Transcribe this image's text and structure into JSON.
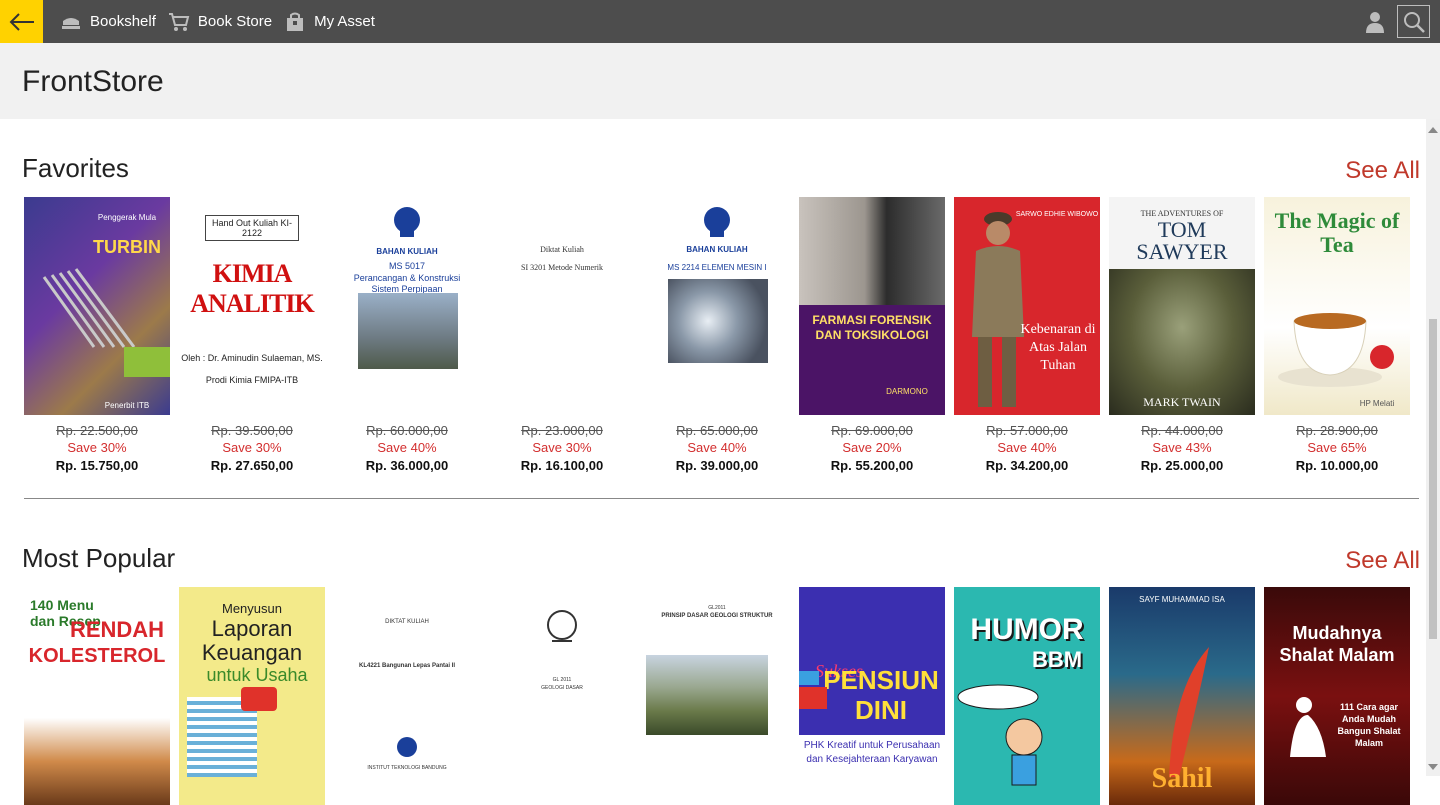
{
  "nav": {
    "items": [
      {
        "label": "Bookshelf",
        "icon": "bookshelf-icon"
      },
      {
        "label": "Book Store",
        "icon": "cart-icon"
      },
      {
        "label": "My Asset",
        "icon": "bag-icon"
      }
    ]
  },
  "page": {
    "title": "FrontStore"
  },
  "favorites": {
    "title": "Favorites",
    "see_all": "See All",
    "books": [
      {
        "cover_lines": [
          "Penggerak Mula",
          "TURBIN",
          "Penerbit ITB"
        ],
        "old_price": "Rp. 22.500,00",
        "save": "Save 30%",
        "price": "Rp. 15.750,00"
      },
      {
        "cover_lines": [
          "Hand Out Kuliah KI-2122",
          "KIMIA ANALITIK",
          "Oleh : Dr. Aminudin Sulaeman, MS.",
          "Prodi Kimia FMIPA-ITB"
        ],
        "old_price": "Rp. 39.500,00",
        "save": "Save 30%",
        "price": "Rp. 27.650,00"
      },
      {
        "cover_lines": [
          "BAHAN KULIAH",
          "MS 5017",
          "Perancangan & Konstruksi",
          "Sistem Perpipaan"
        ],
        "old_price": "Rp. 60.000,00",
        "save": "Save 40%",
        "price": "Rp. 36.000,00"
      },
      {
        "cover_lines": [
          "Diktat Kuliah",
          "SI 3201 Metode Numerik"
        ],
        "old_price": "Rp. 23.000,00",
        "save": "Save 30%",
        "price": "Rp. 16.100,00"
      },
      {
        "cover_lines": [
          "BAHAN KULIAH",
          "MS 2214 ELEMEN MESIN I"
        ],
        "old_price": "Rp. 65.000,00",
        "save": "Save 40%",
        "price": "Rp. 39.000,00"
      },
      {
        "cover_lines": [
          "FARMASI FORENSIK DAN TOKSIKOLOGI",
          "DARMONO"
        ],
        "old_price": "Rp. 69.000,00",
        "save": "Save 20%",
        "price": "Rp. 55.200,00"
      },
      {
        "cover_lines": [
          "SARWO EDHIE WIBOWO",
          "Kebenaran di Atas Jalan Tuhan"
        ],
        "old_price": "Rp. 57.000,00",
        "save": "Save 40%",
        "price": "Rp. 34.200,00"
      },
      {
        "cover_lines": [
          "THE ADVENTURES OF",
          "TOM SAWYER",
          "MARK TWAIN"
        ],
        "old_price": "Rp. 44.000,00",
        "save": "Save 43%",
        "price": "Rp. 25.000,00"
      },
      {
        "cover_lines": [
          "The Magic of Tea",
          "HP Melati"
        ],
        "old_price": "Rp. 28.900,00",
        "save": "Save 65%",
        "price": "Rp. 10.000,00"
      }
    ]
  },
  "popular": {
    "title": "Most Popular",
    "see_all": "See All",
    "books": [
      {
        "cover_lines": [
          "140 Menu dan Resep",
          "RENDAH",
          "KOLESTEROL"
        ]
      },
      {
        "cover_lines": [
          "Menyusun",
          "Laporan Keuangan",
          "untuk Usaha"
        ]
      },
      {
        "cover_lines": [
          "DIKTAT KULIAH",
          "KL4221 Bangunan Lepas Pantai II",
          "INSTITUT TEKNOLOGI BANDUNG"
        ]
      },
      {
        "cover_lines": [
          "GL 2011",
          "GEOLOGI DASAR"
        ]
      },
      {
        "cover_lines": [
          "GL2011",
          "PRINSIP DASAR GEOLOGI STRUKTUR"
        ]
      },
      {
        "cover_lines": [
          "Sukses",
          "PENSIUN DINI",
          "PHK Kreatif untuk Perusahaan dan Kesejahteraan Karyawan"
        ]
      },
      {
        "cover_lines": [
          "HUMOR",
          "BBM"
        ]
      },
      {
        "cover_lines": [
          "SAYF MUHAMMAD ISA",
          "Sahil"
        ]
      },
      {
        "cover_lines": [
          "Mudahnya",
          "Shalat Malam",
          "111 Cara agar Anda Mudah Bangun Shalat Malam"
        ]
      }
    ]
  }
}
